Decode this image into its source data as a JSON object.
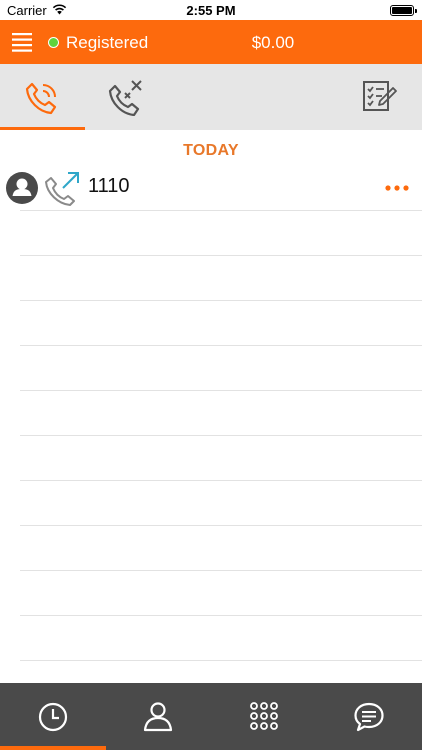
{
  "status_bar": {
    "carrier": "Carrier",
    "time": "2:55 PM"
  },
  "header": {
    "menu_icon": "hamburger-menu-icon",
    "registration_status": "Registered",
    "status_color": "#5fd33c",
    "balance": "$0.00",
    "brand_color": "#fd6a0d"
  },
  "tabs": [
    {
      "icon": "call-history-icon",
      "selected": true
    },
    {
      "icon": "missed-calls-icon",
      "selected": false
    },
    {
      "icon": "checklist-edit-icon",
      "selected": false
    }
  ],
  "call_log": {
    "section_title": "TODAY",
    "entries": [
      {
        "number": "1110",
        "direction": "outgoing",
        "avatar_icon": "person-icon",
        "more_icon": "more-dots-icon"
      }
    ]
  },
  "bottom_nav": [
    {
      "icon": "recents-clock-icon",
      "selected": true
    },
    {
      "icon": "contacts-person-icon",
      "selected": false
    },
    {
      "icon": "keypad-icon",
      "selected": false
    },
    {
      "icon": "chat-icon",
      "selected": false
    }
  ]
}
